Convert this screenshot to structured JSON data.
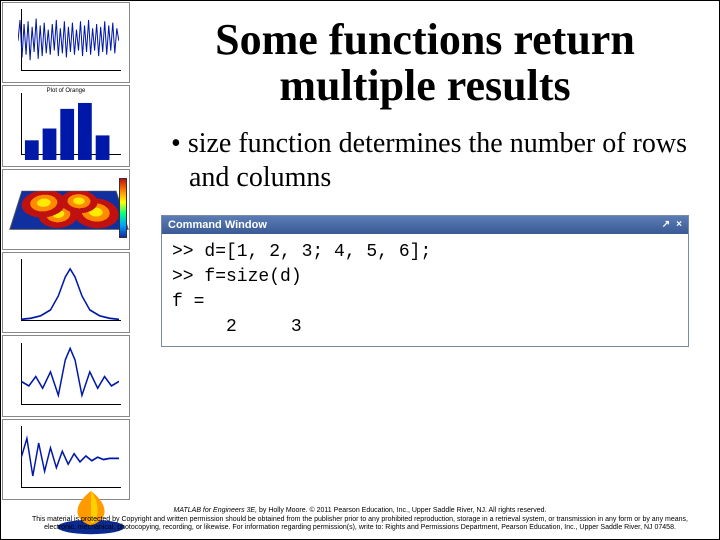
{
  "title": "Some functions return multiple results",
  "bullet1": "size function determines the number of rows and columns",
  "commandWindow": {
    "title": "Command Window",
    "undock": "↗",
    "close": "×",
    "lines": ">> d=[1, 2, 3; 4, 5, 6];\n>> f=size(d)\nf =\n     2     3"
  },
  "footer": {
    "line1_book": "MATLAB for Engineers 3E,",
    "line1_rest": " by Holly Moore. © 2011 Pearson Education, Inc., Upper Saddle River, NJ.  All rights reserved.",
    "line2": "This material is protected by Copyright and written permission should be obtained from the publisher prior to any prohibited reproduction, storage in a retrieval system, or transmission in any form or by any means, electronic, mechanical, photocopying, recording, or likewise. For information regarding permission(s), write to: Rights and Permissions Department, Pearson Education, Inc., Upper Saddle River, NJ 07458."
  },
  "thumbs": {
    "t2_label": "Plot of Orange"
  }
}
